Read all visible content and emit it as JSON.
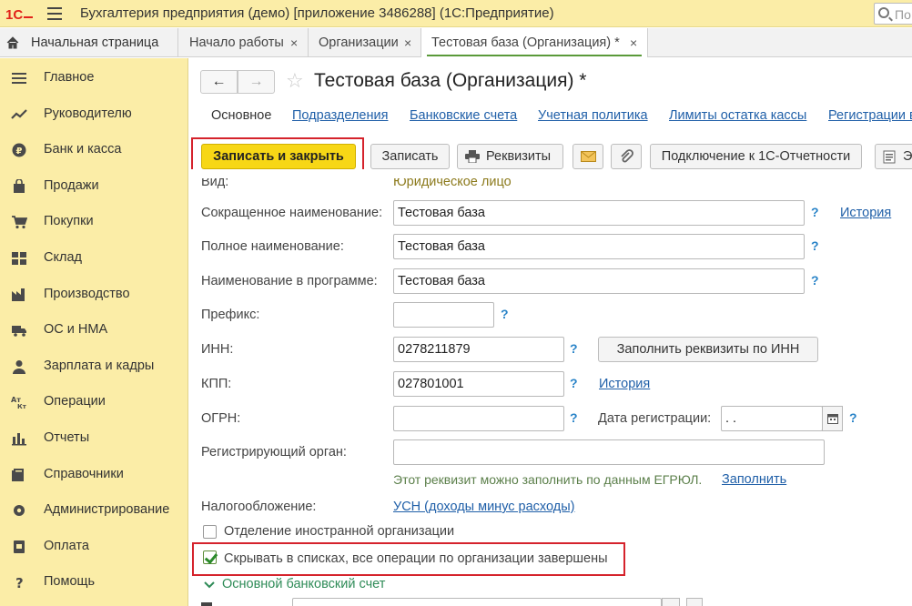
{
  "app": {
    "logo": "1С",
    "title": "Бухгалтерия предприятия (демо) [приложение 3486288] (1С:Предприятие)",
    "search_placeholder": "По"
  },
  "tabs": {
    "home": "Начальная страница",
    "items": [
      {
        "label": "Начало работы",
        "close": "×"
      },
      {
        "label": "Организации",
        "close": "×"
      },
      {
        "label": "Тестовая база (Организация) *",
        "close": "×"
      }
    ]
  },
  "sidebar": {
    "items": [
      {
        "label": "Главное",
        "icon": "menu-lines-icon"
      },
      {
        "label": "Руководителю",
        "icon": "trend-icon"
      },
      {
        "label": "Банк и касса",
        "icon": "ruble-icon"
      },
      {
        "label": "Продажи",
        "icon": "bag-icon"
      },
      {
        "label": "Покупки",
        "icon": "cart-icon"
      },
      {
        "label": "Склад",
        "icon": "warehouse-icon"
      },
      {
        "label": "Производство",
        "icon": "factory-icon"
      },
      {
        "label": "ОС и НМА",
        "icon": "truck-icon"
      },
      {
        "label": "Зарплата и кадры",
        "icon": "person-icon"
      },
      {
        "label": "Операции",
        "icon": "operations-icon"
      },
      {
        "label": "Отчеты",
        "icon": "bar-chart-icon"
      },
      {
        "label": "Справочники",
        "icon": "books-icon"
      },
      {
        "label": "Администрирование",
        "icon": "gear-icon"
      },
      {
        "label": "Оплата",
        "icon": "payment-icon"
      },
      {
        "label": "Помощь",
        "icon": "help-icon"
      }
    ]
  },
  "form": {
    "nav_back": "←",
    "nav_forward": "→",
    "star": "☆",
    "title": "Тестовая база (Организация) *",
    "subtabs": [
      "Основное",
      "Подразделения",
      "Банковские счета",
      "Учетная политика",
      "Лимиты остатка кассы",
      "Регистрации в"
    ],
    "toolbar": {
      "save_close": "Записать и закрыть",
      "save": "Записать",
      "details": "Реквизиты",
      "connect": "Подключение к 1С-Отчетности",
      "more": "Э"
    },
    "fields": {
      "kind_label": "Вид:",
      "kind_value": "Юридическое лицо",
      "short_name_label": "Сокращенное наименование:",
      "short_name_value": "Тестовая база",
      "history1": "История",
      "full_name_label": "Полное наименование:",
      "full_name_value": "Тестовая база",
      "prog_name_label": "Наименование в программе:",
      "prog_name_value": "Тестовая база",
      "prefix_label": "Префикс:",
      "prefix_value": "",
      "inn_label": "ИНН:",
      "inn_value": "0278211879",
      "fill_by_inn": "Заполнить реквизиты по ИНН",
      "kpp_label": "КПП:",
      "kpp_value": "027801001",
      "history2": "История",
      "ogrn_label": "ОГРН:",
      "ogrn_value": "",
      "reg_date_label": "Дата регистрации:",
      "reg_date_value": " .  .",
      "reg_organ_label": "Регистрирующий орган:",
      "reg_organ_value": "",
      "egrul_hint": "Этот реквизит можно заполнить по данным ЕГРЮЛ.",
      "fill_link": "Заполнить",
      "tax_label": "Налогообложение:",
      "tax_value": "УСН (доходы минус расходы)",
      "foreign_branch": "Отделение иностранной организации",
      "hide_in_lists": "Скрывать в списках, все операции по организации завершены",
      "bank_section": "Основной банковский счет",
      "q": "?"
    }
  }
}
